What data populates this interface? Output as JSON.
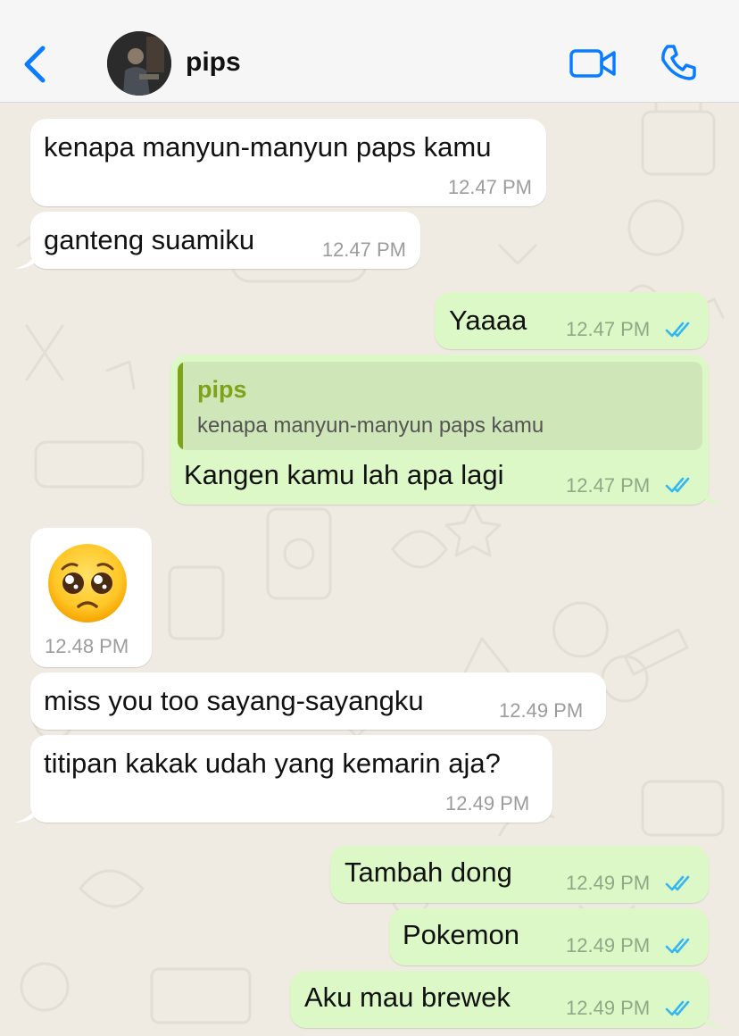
{
  "header": {
    "contact_name": "pips"
  },
  "icons": {
    "back": "chevron-left-icon",
    "video": "video-camera-icon",
    "call": "phone-icon",
    "read": "double-check-icon",
    "emoji": "pleading-face-emoji"
  },
  "colors": {
    "accent": "#0a7cff",
    "incoming_bubble": "#ffffff",
    "outgoing_bubble": "#dcf8c6",
    "quote_accent": "#7ea31a",
    "read_ticks": "#34b7f1",
    "chat_background": "#efeae2"
  },
  "messages": [
    {
      "direction": "incoming",
      "text": "kenapa manyun-manyun paps kamu",
      "time": "12.47 PM"
    },
    {
      "direction": "incoming",
      "text": "ganteng suamiku",
      "time": "12.47 PM"
    },
    {
      "direction": "outgoing",
      "text": "Yaaaa",
      "time": "12.47 PM",
      "status": "read"
    },
    {
      "direction": "outgoing",
      "text": "Kangen kamu lah apa lagi",
      "time": "12.47 PM",
      "status": "read",
      "quoted": {
        "name": "pips",
        "text": "kenapa manyun-manyun paps kamu"
      }
    },
    {
      "direction": "incoming",
      "text": "🥺",
      "time": "12.48 PM"
    },
    {
      "direction": "incoming",
      "text": "miss you too sayang-sayangku",
      "time": "12.49 PM"
    },
    {
      "direction": "incoming",
      "text": "titipan kakak udah yang kemarin aja?",
      "time": "12.49 PM"
    },
    {
      "direction": "outgoing",
      "text": "Tambah dong",
      "time": "12.49 PM",
      "status": "read"
    },
    {
      "direction": "outgoing",
      "text": "Pokemon",
      "time": "12.49 PM",
      "status": "read"
    },
    {
      "direction": "outgoing",
      "text": "Aku mau brewek",
      "time": "12.49 PM",
      "status": "read"
    }
  ]
}
